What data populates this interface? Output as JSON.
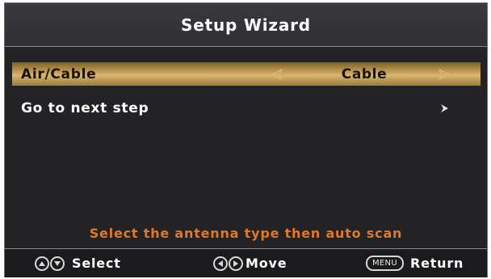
{
  "title": "Setup Wizard",
  "rows": [
    {
      "label": "Air/Cable",
      "value": "Cable",
      "selected": true
    },
    {
      "label": "Go to next step"
    }
  ],
  "hint": "Select the antenna type then auto scan",
  "footer": {
    "select_label": "Select",
    "move_label": "Move",
    "menu_key": "MENU",
    "return_label": "Return"
  },
  "colors": {
    "hint": "#e0782c",
    "highlight": "#c9a25c",
    "background": "#232325"
  },
  "icons": [
    "arrow-left-icon",
    "arrow-right-icon",
    "chevron-right-icon",
    "up-icon",
    "down-icon",
    "left-icon",
    "right-icon"
  ]
}
